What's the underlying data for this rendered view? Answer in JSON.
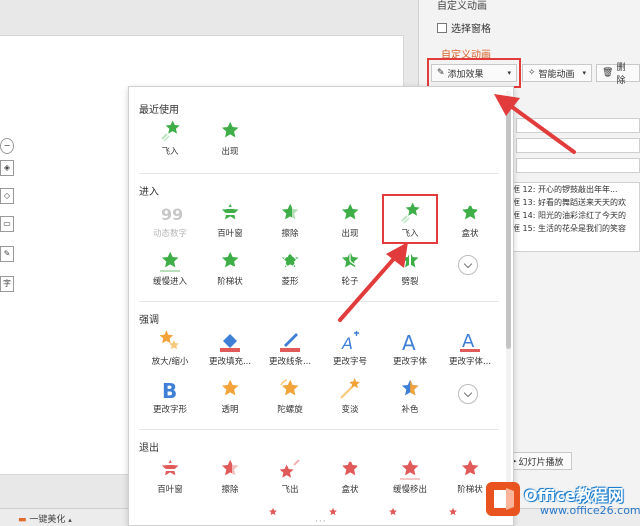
{
  "pane": {
    "title": "自定义动画",
    "select_pane": "选择窗格",
    "custom_animation": "自定义动画",
    "add_effect": "添加效果",
    "smart_animation": "智能动画",
    "delete": "删除",
    "animation_list": [
      "框 12: 开心的锣鼓敲出年年...",
      "框 13: 好看的舞蹈送来天天的欢",
      "框 14: 阳光的油彩涂红了今天的",
      "框 15: 生活的花朵是我们的笑容"
    ],
    "slideshow_play": "幻灯片播放"
  },
  "statusbar": {
    "beautify": "一键美化"
  },
  "left_tools": [
    "字"
  ],
  "dropdown": {
    "recent": {
      "title": "最近使用",
      "items": [
        "飞入",
        "出现"
      ]
    },
    "entrance": {
      "title": "进入",
      "row1": [
        "动态数字",
        "百叶窗",
        "擦除",
        "出现",
        "飞入",
        "盒状"
      ],
      "row2": [
        "缓慢进入",
        "阶梯状",
        "菱形",
        "轮子",
        "劈裂"
      ]
    },
    "emphasis": {
      "title": "强调",
      "row1": [
        "放大/缩小",
        "更改填充...",
        "更改线条...",
        "更改字号",
        "更改字体",
        "更改字体..."
      ],
      "row2": [
        "更改字形",
        "透明",
        "陀螺旋",
        "变淡",
        "补色"
      ]
    },
    "exit": {
      "title": "退出",
      "row1": [
        "百叶窗",
        "擦除",
        "飞出",
        "盒状",
        "缓慢移出",
        "阶梯状"
      ]
    }
  },
  "colors": {
    "entrance_green": "#3fae49",
    "emphasis_orange": "#f2a33a",
    "exit_red": "#e05a5a",
    "accent_red": "#e23b3b",
    "font_blue": "#3f7fd6"
  },
  "watermark": {
    "title": "Office教程网",
    "url": "www.office26.com"
  }
}
